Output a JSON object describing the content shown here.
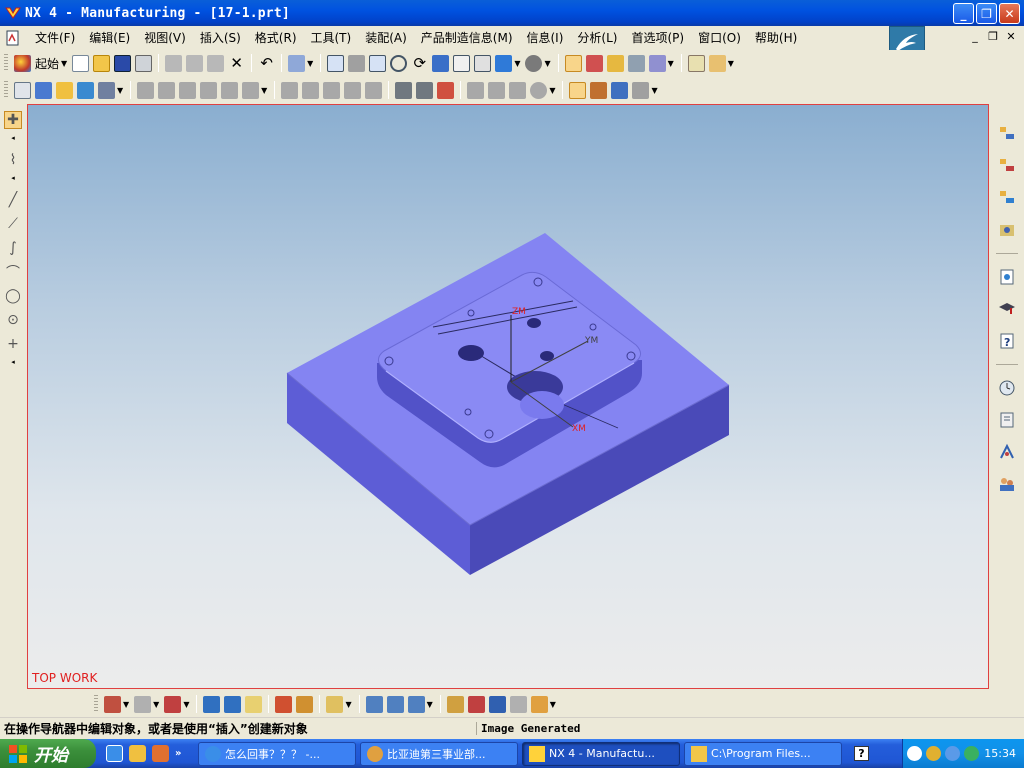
{
  "window": {
    "title": "NX 4 - Manufacturing - [17-1.prt]",
    "buttons": {
      "minimize": "_",
      "maximize": "❐",
      "close": "✕"
    }
  },
  "menubar": {
    "items": [
      {
        "label": "文件(F)"
      },
      {
        "label": "编辑(E)"
      },
      {
        "label": "视图(V)"
      },
      {
        "label": "插入(S)"
      },
      {
        "label": "格式(R)"
      },
      {
        "label": "工具(T)"
      },
      {
        "label": "装配(A)"
      },
      {
        "label": "产品制造信息(M)"
      },
      {
        "label": "信息(I)"
      },
      {
        "label": "分析(L)"
      },
      {
        "label": "首选项(P)"
      },
      {
        "label": "窗口(O)"
      },
      {
        "label": "帮助(H)"
      }
    ],
    "mdi_buttons": {
      "minimize": "_",
      "restore": "❐",
      "close": "✕"
    }
  },
  "toolbar": {
    "start_label": "起始"
  },
  "viewport": {
    "view_label": "TOP WORK",
    "axes": {
      "z": "ZM",
      "y": "YM",
      "x": "XM"
    },
    "colors": {
      "part_top": "#8080f0",
      "part_front": "#5a5ad2",
      "part_side": "#4848b8",
      "axis_label": "#e02020"
    }
  },
  "statusbar": {
    "prompt": "在操作导航器中编辑对象，或者是使用“插入”创建新对象",
    "message": "Image Generated"
  },
  "taskbar": {
    "start_label": "开始",
    "quicklaunch_more": "»",
    "tasks": [
      {
        "label": "怎么回事？？？ -..."
      },
      {
        "label": "比亚迪第三事业部..."
      },
      {
        "label": "NX 4 - Manufactu..."
      },
      {
        "label": "C:\\Program Files..."
      }
    ],
    "help_label": "?",
    "clock": "15:34"
  }
}
